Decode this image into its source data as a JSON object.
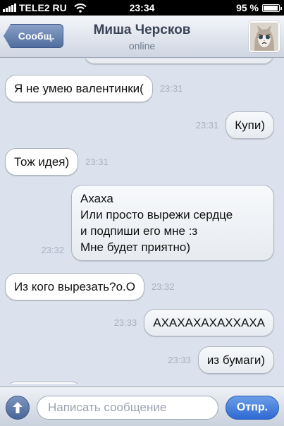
{
  "status_bar": {
    "carrier": "TELE2 RU",
    "time": "23:34",
    "battery_percent": "95 %",
    "battery_level": 0.95,
    "signal_icon": "signal-bars-icon",
    "wifi_icon": "wifi-icon"
  },
  "header": {
    "back_label": "Сообщ.",
    "contact_name": "Миша Черсков",
    "status": "online",
    "avatar_icon": "cat-avatar-icon"
  },
  "messages": [
    {
      "direction": "in",
      "text": "Я не умею валентинки(",
      "time": "23:31"
    },
    {
      "direction": "out",
      "text": "Купи)",
      "time": "23:31"
    },
    {
      "direction": "in",
      "text": "Тож идея)",
      "time": "23:31"
    },
    {
      "direction": "out",
      "text": "Ахаха\nИли просто вырежи  сердце\nи подпиши его мне :з\nМне будет приятно)",
      "time": "23:32"
    },
    {
      "direction": "in",
      "text": "Из кого вырезать?о.О",
      "time": "23:32"
    },
    {
      "direction": "out",
      "text": "АХАХАХАХАХХАХА",
      "time": "23:33"
    },
    {
      "direction": "out",
      "text": "из бумаги)",
      "time": "23:33"
    }
  ],
  "composer": {
    "placeholder": "Написать сообщение",
    "send_label": "Отпр.",
    "attach_icon": "arrow-up-icon"
  },
  "colors": {
    "background": "#dbe2ed",
    "send_button": "#2d6ad2",
    "back_button": "#4f6e9f",
    "timestamp": "#a8b2c2"
  }
}
